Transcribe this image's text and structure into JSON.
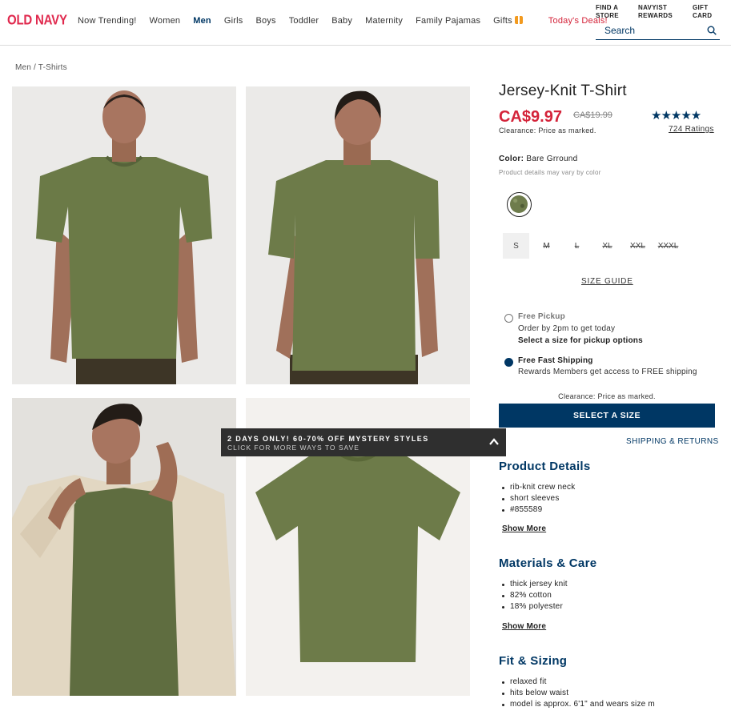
{
  "header": {
    "logo": "OLD NAVY",
    "nav": [
      {
        "label": "Now Trending!",
        "style": "normal"
      },
      {
        "label": "Women",
        "style": "normal"
      },
      {
        "label": "Men",
        "style": "active"
      },
      {
        "label": "Girls",
        "style": "normal"
      },
      {
        "label": "Boys",
        "style": "normal"
      },
      {
        "label": "Toddler",
        "style": "normal"
      },
      {
        "label": "Baby",
        "style": "normal"
      },
      {
        "label": "Maternity",
        "style": "normal"
      },
      {
        "label": "Family Pajamas",
        "style": "normal"
      },
      {
        "label": "Gifts",
        "style": "gift"
      },
      {
        "label": "Today's Deals!",
        "style": "deals"
      }
    ],
    "utils": {
      "find_store_line1": "FIND A",
      "find_store_line2": "STORE",
      "navyist_line1": "NAVYIST",
      "navyist_line2": "REWARDS",
      "gift_card_line1": "GIFT",
      "gift_card_line2": "CARD"
    },
    "search_placeholder": "Search"
  },
  "breadcrumb": "Men / T-Shirts",
  "promo": {
    "title": "2 DAYS ONLY! 60-70% OFF MYSTERY STYLES",
    "subtitle": "CLICK FOR MORE WAYS TO SAVE"
  },
  "product": {
    "title": "Jersey-Knit T-Shirt",
    "price": "CA$9.97",
    "original_price": "CA$19.99",
    "clearance_note": "Clearance: Price as marked.",
    "stars": "★★★★★",
    "rating_value": 4.8,
    "ratings_label": "724 Ratings",
    "color_label": "Color:",
    "color_value": "Bare Grround",
    "color_hint": "Product details may vary by color",
    "swatch_color": "#6e7c4c",
    "sizes": [
      {
        "label": "S",
        "available": true,
        "selected": true
      },
      {
        "label": "M",
        "available": false
      },
      {
        "label": "L",
        "available": false
      },
      {
        "label": "XL",
        "available": false
      },
      {
        "label": "XXL",
        "available": false
      },
      {
        "label": "XXXL",
        "available": false
      }
    ],
    "size_guide": "SIZE GUIDE"
  },
  "fulfillment": {
    "pickup_title": "Free Pickup",
    "pickup_line1": "Order by 2pm to get today",
    "pickup_line2": "Select a size for pickup options",
    "ship_title": "Free Fast Shipping",
    "ship_line1": "Rewards Members get access to FREE shipping"
  },
  "cta": {
    "clearance": "Clearance: Price as marked.",
    "button": "SELECT A SIZE",
    "shipping_link": "SHIPPING & RETURNS"
  },
  "sections": {
    "details_title": "Product Details",
    "details": [
      "rib-knit crew neck",
      "short sleeves",
      "#855589"
    ],
    "materials_title": "Materials & Care",
    "materials": [
      "thick jersey knit",
      "82% cotton",
      "18% polyester"
    ],
    "fit_title": "Fit & Sizing",
    "fit": [
      "relaxed fit",
      "hits below waist",
      "model is approx. 6'1\" and wears size m"
    ],
    "show_more": "Show More"
  },
  "colors": {
    "brand_red": "#e0284d",
    "navy": "#003764",
    "sale_red": "#d4243a",
    "shirt_green": "#6e7c4c"
  }
}
